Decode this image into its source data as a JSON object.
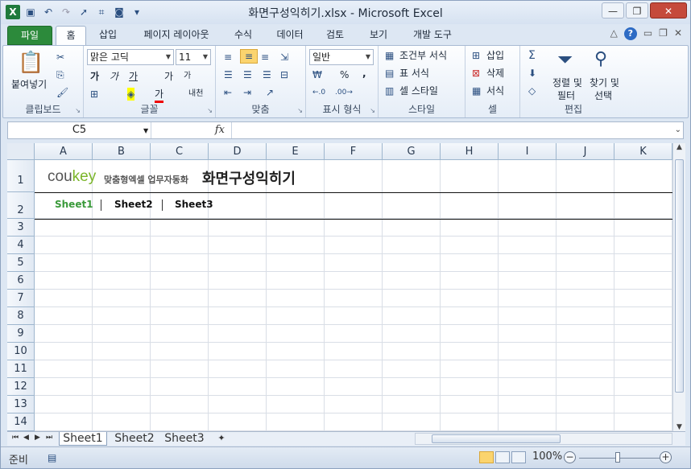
{
  "window": {
    "title": "화면구성익히기.xlsx - Microsoft Excel"
  },
  "tabs": [
    "파일",
    "홈",
    "삽입",
    "페이지 레이아웃",
    "수식",
    "데이터",
    "검토",
    "보기",
    "개발 도구"
  ],
  "ribbon": {
    "clipboard": {
      "paste": "붙여넣기",
      "label": "클립보드"
    },
    "font": {
      "name": "맑은 고딕",
      "size": "11",
      "label": "글꼴",
      "bold": "가",
      "italic": "가",
      "underline": "가",
      "grow": "가",
      "shrink": "가",
      "phonetic": "내천",
      "fontcolor": "가"
    },
    "align": {
      "label": "맞춤"
    },
    "number": {
      "format": "일반",
      "label": "표시 형식",
      "percent": "%",
      "comma": ","
    },
    "styles": {
      "cond": "조건부 서식",
      "table": "표 서식",
      "cell": "셀 스타일",
      "label": "스타일"
    },
    "cells": {
      "insert": "삽입",
      "delete": "삭제",
      "format": "서식",
      "label": "셀"
    },
    "editing": {
      "sort": "정렬 및",
      "sort2": "필터",
      "find": "찾기 및",
      "find2": "선택",
      "label": "편집"
    }
  },
  "formula": {
    "namebox": "C5",
    "fx": "fx"
  },
  "columns": [
    "A",
    "B",
    "C",
    "D",
    "E",
    "F",
    "G",
    "H",
    "I",
    "J",
    "K"
  ],
  "rows": [
    "1",
    "2",
    "3",
    "4",
    "5",
    "6",
    "7",
    "8",
    "9",
    "10",
    "11",
    "12",
    "13",
    "14"
  ],
  "sheet": {
    "logo_prefix": "cou",
    "logo_suffix": "key",
    "tagline": "맞춤형엑셀 업무자동화",
    "title": "화면구성익히기",
    "nav": [
      "Sheet1",
      "Sheet2",
      "Sheet3"
    ]
  },
  "sheet_tabs": [
    "Sheet1",
    "Sheet2",
    "Sheet3"
  ],
  "status": {
    "ready": "준비",
    "zoom": "100%"
  },
  "colors": {
    "accent": "#2c8a3b",
    "logo_green": "#7bb52a"
  }
}
